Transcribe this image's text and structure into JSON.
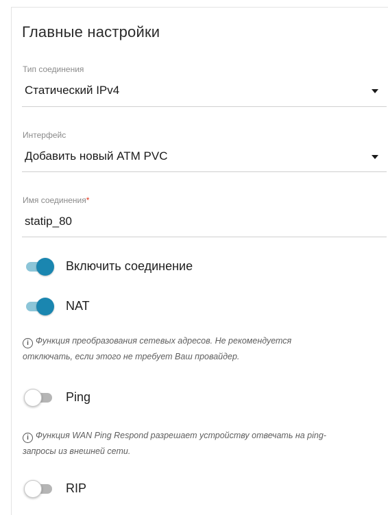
{
  "section": {
    "title": "Главные настройки"
  },
  "connection_type": {
    "label": "Тип соединения",
    "value": "Статический IPv4"
  },
  "interface": {
    "label": "Интерфейс",
    "value": "Добавить новый ATM PVC"
  },
  "connection_name": {
    "label": "Имя соединения",
    "required_mark": "*",
    "value": "statip_80"
  },
  "toggles": {
    "enable_connection": {
      "label": "Включить соединение",
      "state": "on"
    },
    "nat": {
      "label": "NAT",
      "state": "on",
      "hint_line1": "Функция преобразования сетевых адресов. Не рекомендуется",
      "hint_line2": "отключать, если этого не требует Ваш провайдер."
    },
    "ping": {
      "label": "Ping",
      "state": "off",
      "hint_line1": "Функция WAN Ping Respond разрешает устройству отвечать на ping-",
      "hint_line2": "запросы из внешней сети."
    },
    "rip": {
      "label": "RIP",
      "state": "off"
    }
  },
  "icons": {
    "info": "info-icon",
    "dropdown": "caret-down-icon"
  },
  "colors": {
    "toggle_on": "#1a86b0",
    "toggle_on_track": "#8cc5d8",
    "toggle_off_track": "#b5b5b5",
    "required": "#e2331b"
  }
}
